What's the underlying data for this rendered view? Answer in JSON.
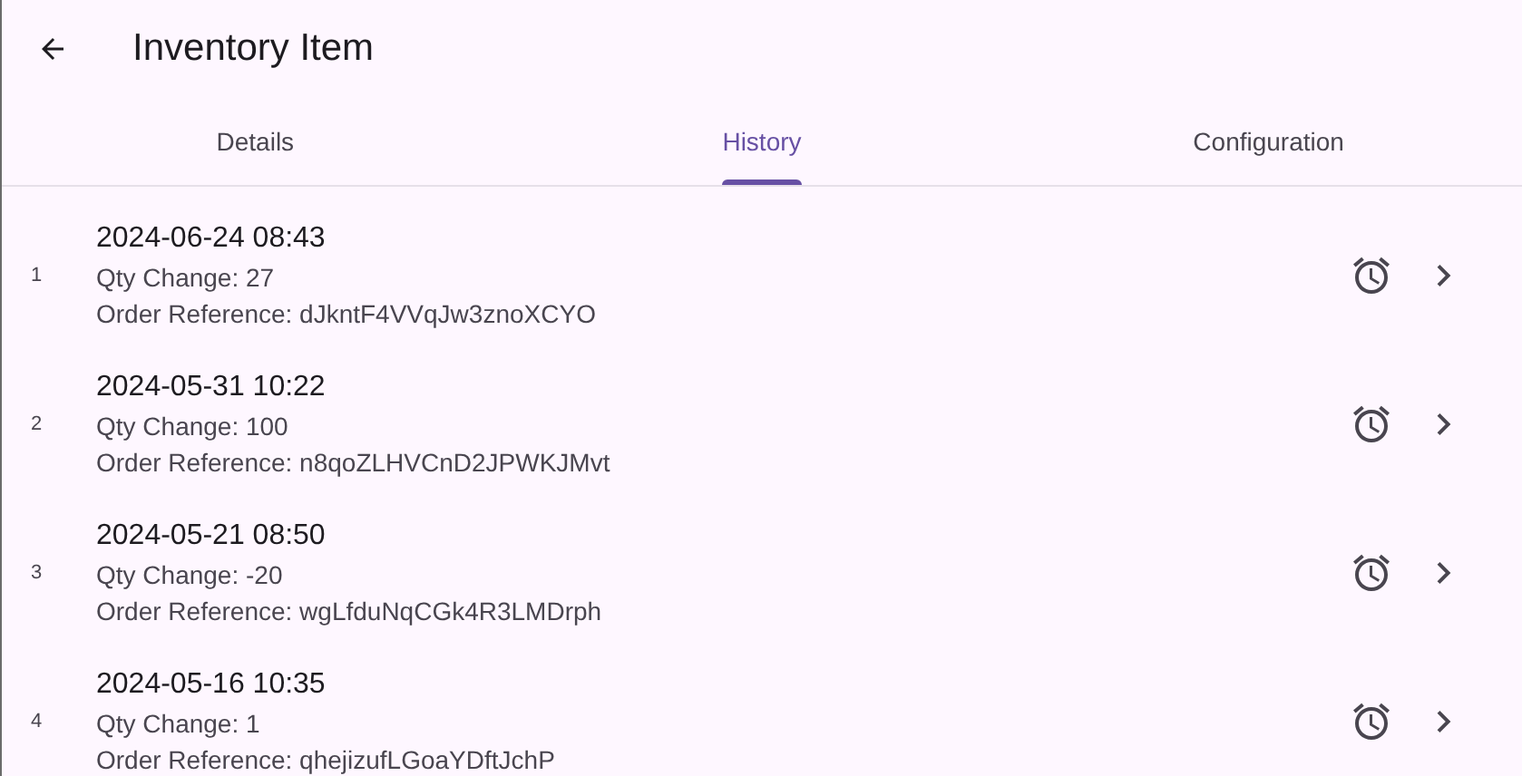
{
  "app_bar": {
    "title": "Inventory Item"
  },
  "tabs": [
    {
      "label": "Details",
      "selected": false
    },
    {
      "label": "History",
      "selected": true
    },
    {
      "label": "Configuration",
      "selected": false
    }
  ],
  "history": [
    {
      "index": "1",
      "date": "2024-06-24 08:43",
      "qty": "Qty Change: 27",
      "reference": "Order Reference: dJkntF4VVqJw3znoXCYO"
    },
    {
      "index": "2",
      "date": "2024-05-31 10:22",
      "qty": "Qty Change: 100",
      "reference": "Order Reference: n8qoZLHVCnD2JPWKJMvt"
    },
    {
      "index": "3",
      "date": "2024-05-21 08:50",
      "qty": "Qty Change: -20",
      "reference": "Order Reference: wgLfduNqCGk4R3LMDrph"
    },
    {
      "index": "4",
      "date": "2024-05-16 10:35",
      "qty": "Qty Change: 1",
      "reference": "Order Reference: qhejizufLGoaYDftJchP"
    }
  ]
}
